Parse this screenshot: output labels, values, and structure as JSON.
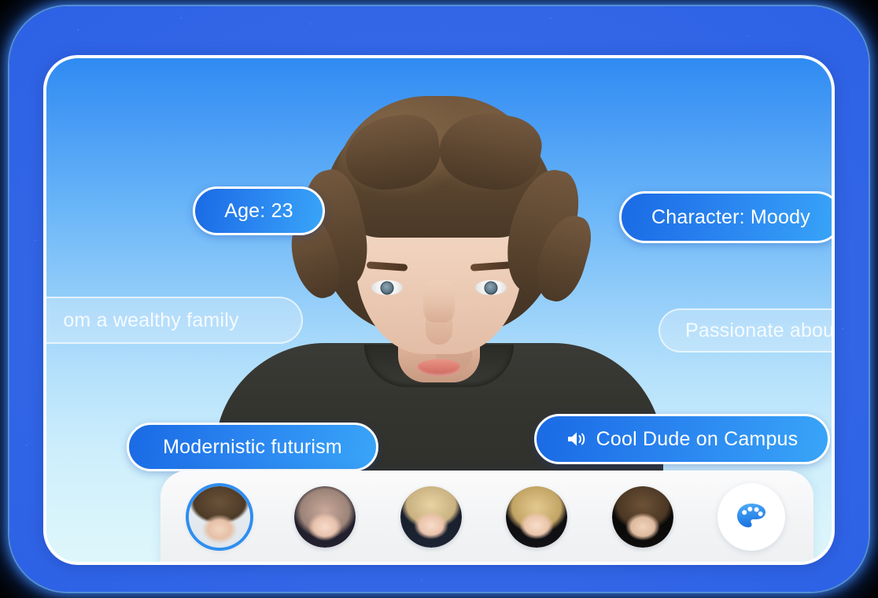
{
  "frame": {
    "glow_color": "#2f63e6",
    "card_border_color": "#ffffff",
    "card_gradient_top": "#2f8bf2",
    "card_gradient_bottom": "#ddf6fb"
  },
  "character": {
    "portrait_alt": "young-man-brown-wavy-hair-dark-tshirt"
  },
  "attributes": [
    {
      "id": "age",
      "label": "Age: 23",
      "style": "solid",
      "icon": null
    },
    {
      "id": "character",
      "label": "Character: Moody",
      "style": "solid",
      "icon": null
    },
    {
      "id": "family",
      "label": "om a wealthy family",
      "style": "ghost",
      "icon": null
    },
    {
      "id": "passion",
      "label": "Passionate about yo",
      "style": "ghost",
      "icon": null
    },
    {
      "id": "style",
      "label": "Modernistic futurism",
      "style": "solid",
      "icon": null
    },
    {
      "id": "voice",
      "label": "Cool Dude on Campus",
      "style": "solid",
      "icon": "speaker-icon"
    }
  ],
  "avatar_bar": {
    "selected_index": 0,
    "selection_ring_color": "#2f8ef0",
    "avatars": [
      {
        "name": "avatar-1-brown-haired-young-man",
        "selected": true
      },
      {
        "name": "avatar-2-long-pink-hair-woman",
        "selected": false
      },
      {
        "name": "avatar-3-blonde-updo-woman",
        "selected": false
      },
      {
        "name": "avatar-4-blonde-woman-earrings",
        "selected": false
      },
      {
        "name": "avatar-5-curly-brown-hair-man",
        "selected": false
      }
    ],
    "palette_button": {
      "name": "palette-icon",
      "color_start": "#4facfa",
      "color_end": "#1b74e0"
    }
  }
}
